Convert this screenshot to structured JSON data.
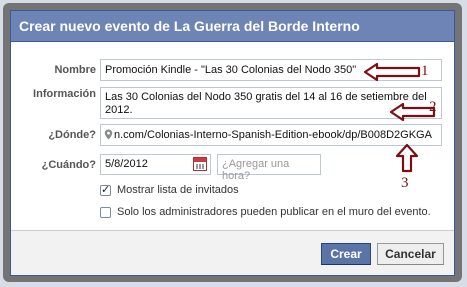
{
  "dialog": {
    "title": "Crear nuevo evento de La Guerra del Borde Interno"
  },
  "form": {
    "name_label": "Nombre",
    "name_value": "Promoción Kindle - \"Las 30 Colonias del Nodo 350\"",
    "info_label": "Información",
    "info_line1": "Las 30 Colonias del Nodo 350 gratis del 14 al 16 de setiembre del",
    "info_line2": "2012.",
    "where_label": "¿Dónde?",
    "where_value": "n.com/Colonias-Interno-Spanish-Edition-ebook/dp/B008D2GKGA",
    "when_label": "¿Cuándo?",
    "date_value": "5/8/2012",
    "time_placeholder": "¿Agregar una hora?",
    "show_guests_label": "Mostrar lista de invitados",
    "show_guests_checked": true,
    "admins_only_label": "Solo los administradores pueden publicar en el muro del evento.",
    "admins_only_checked": false
  },
  "annotations": {
    "n1": "1",
    "n2": "2",
    "n3": "3",
    "color": "#7a0f14"
  },
  "buttons": {
    "create": "Crear",
    "cancel": "Cancelar"
  },
  "icons": [
    "calendar-icon",
    "location-pin-icon",
    "check-icon"
  ]
}
